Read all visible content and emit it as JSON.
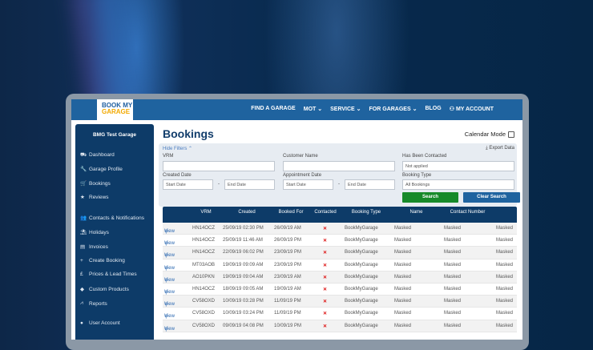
{
  "header": {
    "logo_top": "BOOK MY",
    "logo_bottom": "GARAGE",
    "nav": [
      "FIND A GARAGE",
      "MOT ⌄",
      "SERVICE ⌄",
      "FOR GARAGES ⌄",
      "BLOG"
    ],
    "account": "MY ACCOUNT"
  },
  "sidebar": {
    "garage_name": "BMG Test Garage",
    "items": [
      {
        "label": "Dashboard",
        "icon": "car-icon",
        "glyph": "⛟"
      },
      {
        "label": "Garage Profile",
        "icon": "wrench-icon",
        "glyph": "🔧"
      },
      {
        "label": "Bookings",
        "icon": "cart-icon",
        "glyph": "🛒"
      },
      {
        "label": "Reviews",
        "icon": "star-icon",
        "glyph": "★"
      },
      {
        "label": "Contacts & Notifications",
        "icon": "users-icon",
        "glyph": "👥"
      },
      {
        "label": "Holidays",
        "icon": "umbrella-icon",
        "glyph": "⛱"
      },
      {
        "label": "Invoices",
        "icon": "file-icon",
        "glyph": "▤"
      },
      {
        "label": "Create Booking",
        "icon": "plus-icon",
        "glyph": "+"
      },
      {
        "label": "Prices & Lead Times",
        "icon": "pound-icon",
        "glyph": "£"
      },
      {
        "label": "Custom Products",
        "icon": "tag-icon",
        "glyph": "◆"
      },
      {
        "label": "Reports",
        "icon": "chart-icon",
        "glyph": "⩘"
      },
      {
        "label": "User Account",
        "icon": "user-icon",
        "glyph": "●"
      }
    ]
  },
  "page": {
    "title": "Bookings",
    "calendar_mode": "Calendar Mode"
  },
  "filters": {
    "hide": "Hide Filters ⌃",
    "export": "Export Data",
    "vrm": "VRM",
    "customer": "Customer Name",
    "contacted": "Has Been Contacted",
    "contacted_value": "Not applied",
    "created": "Created Date",
    "appointment": "Appointment Date",
    "type": "Booking Type",
    "type_value": "All Bookings",
    "start": "Start Date",
    "end": "End Date",
    "dash": "-",
    "search": "Search",
    "clear": "Clear Search"
  },
  "table": {
    "headers": [
      "",
      "VRM",
      "Created",
      "Booked For",
      "Contacted",
      "Booking Type",
      "Name",
      "Contact Number",
      ""
    ],
    "view": "View",
    "x": "✕",
    "rows": [
      [
        "HN14OCZ",
        "25/09/19 02:30 PM",
        "26/09/19 AM",
        "BookMyGarage",
        "Masked",
        "Masked",
        "Masked"
      ],
      [
        "HN14OCZ",
        "25/09/19 11:46 AM",
        "26/09/19 PM",
        "BookMyGarage",
        "Masked",
        "Masked",
        "Masked"
      ],
      [
        "HN14OCZ",
        "22/09/19 06:02 PM",
        "23/09/19 PM",
        "BookMyGarage",
        "Masked",
        "Masked",
        "Masked"
      ],
      [
        "MT03AOB",
        "19/09/19 09:09 AM",
        "23/09/19 PM",
        "BookMyGarage",
        "Masked",
        "Masked",
        "Masked"
      ],
      [
        "AO10PKN",
        "19/09/19 09:04 AM",
        "23/09/19 AM",
        "BookMyGarage",
        "Masked",
        "Masked",
        "Masked"
      ],
      [
        "HN14OCZ",
        "18/09/19 09:05 AM",
        "19/09/19 AM",
        "BookMyGarage",
        "Masked",
        "Masked",
        "Masked"
      ],
      [
        "CV58OXD",
        "10/09/19 03:28 PM",
        "11/09/19 PM",
        "BookMyGarage",
        "Masked",
        "Masked",
        "Masked"
      ],
      [
        "CV58OXD",
        "10/09/19 03:24 PM",
        "11/09/19 PM",
        "BookMyGarage",
        "Masked",
        "Masked",
        "Masked"
      ],
      [
        "CV58OXD",
        "09/09/19 04:08 PM",
        "10/09/19 PM",
        "BookMyGarage",
        "Masked",
        "Masked",
        "Masked"
      ]
    ]
  }
}
